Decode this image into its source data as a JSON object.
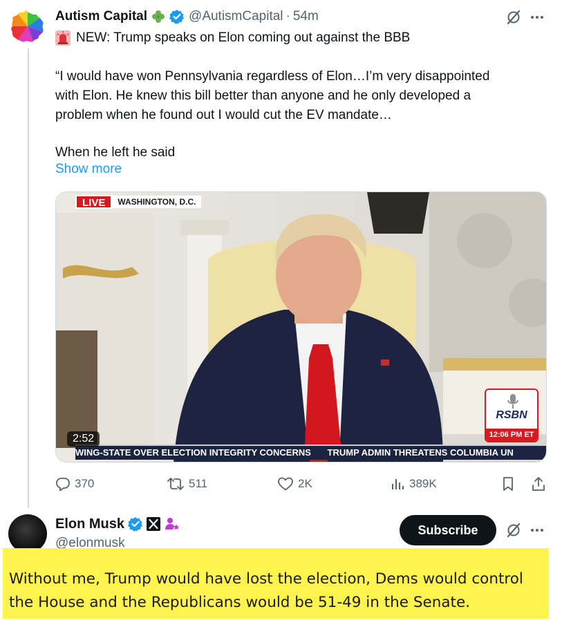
{
  "tweet1": {
    "author_name": "Autism Capital",
    "handle": "@AutismCapital",
    "separator": "·",
    "time": "54m",
    "headline": "NEW: Trump speaks on Elon coming out against the BBB",
    "quote_lines": [
      "“I would have won Pennsylvania regardless of Elon…I’m very disappointed",
      "with Elon. He knew this bill better than anyone and he only developed a",
      "problem when he found out I would cut the EV mandate…"
    ],
    "last_line": "When he left he said",
    "show_more": "Show more",
    "video": {
      "live_label": "LIVE",
      "location": "WASHINGTON, D.C.",
      "duration": "2:52",
      "ticker_left": "WING-STATE OVER ELECTION INTEGRITY CONCERNS",
      "ticker_right": "TRUMP ADMIN THREATENS COLUMBIA UN",
      "network": "RSBN",
      "network_time": "12:06 PM ET"
    },
    "actions": {
      "replies": "370",
      "reposts": "511",
      "likes": "2K",
      "views": "389K"
    },
    "icons": [
      "puzzle-avatar-icon",
      "clover-icon",
      "verified-icon",
      "grok-icon",
      "more-icon",
      "siren-icon",
      "reply-icon",
      "repost-icon",
      "like-icon",
      "views-icon",
      "bookmark-icon",
      "share-icon"
    ]
  },
  "tweet2": {
    "author_name": "Elon Musk",
    "handle": "@elonmusk",
    "subscribe_label": "Subscribe",
    "text": "Without me, Trump would have lost the election, Dems would control the House and the Republicans would be 51-49 in the Senate.",
    "icons": [
      "verified-icon",
      "x-affiliate-icon",
      "person-star-icon",
      "grok-icon",
      "more-icon"
    ]
  },
  "colors": {
    "link": "#1d9bf0",
    "secondary_text": "#536471",
    "highlight": "#fff44d",
    "verified": "#1d9bf0",
    "live_red": "#d71920"
  }
}
